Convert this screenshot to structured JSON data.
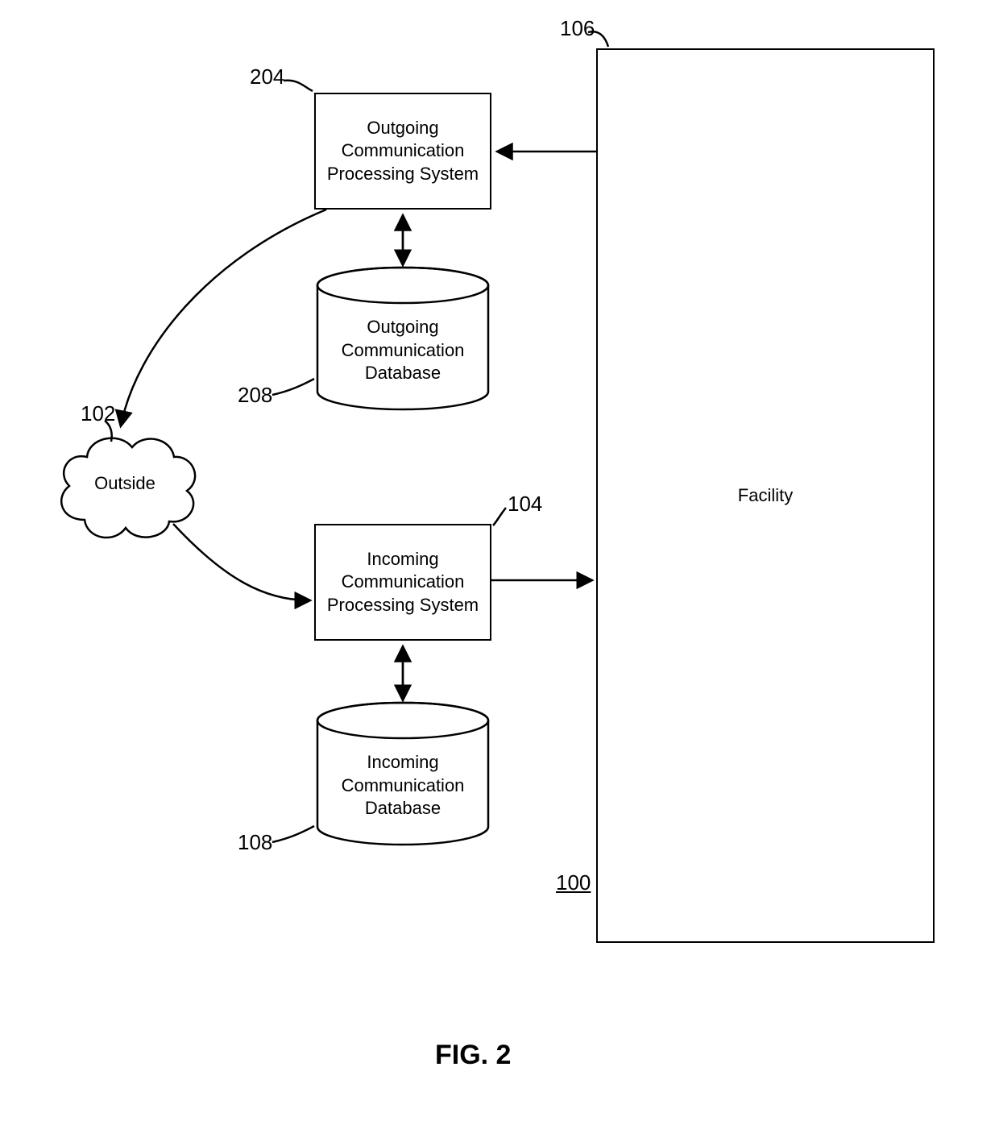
{
  "facility": {
    "label": "Facility",
    "ref": "106"
  },
  "outgoing_sys": {
    "label": "Outgoing\nCommunication\nProcessing System",
    "ref": "204"
  },
  "outgoing_db": {
    "label": "Outgoing\nCommunication\nDatabase",
    "ref": "208"
  },
  "incoming_sys": {
    "label": "Incoming\nCommunication\nProcessing System",
    "ref": "104"
  },
  "incoming_db": {
    "label": "Incoming\nCommunication\nDatabase",
    "ref": "108"
  },
  "outside": {
    "label": "Outside",
    "ref": "102"
  },
  "figure": {
    "caption": "FIG. 2",
    "ref": "100"
  }
}
